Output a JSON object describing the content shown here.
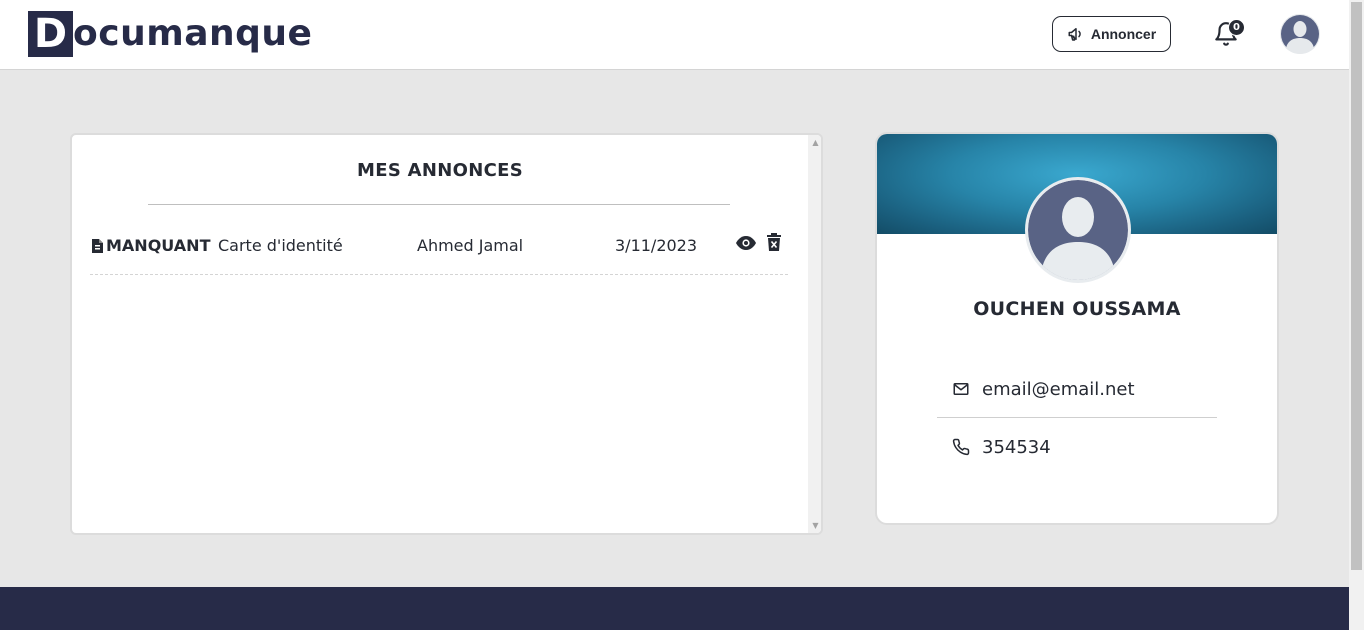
{
  "header": {
    "logo_letter": "D",
    "logo_rest": "ocumanque",
    "annoncer_label": "Annoncer",
    "notification_count": "0"
  },
  "annonces": {
    "title": "MES ANNONCES",
    "rows": [
      {
        "type": "MANQUANT",
        "document": "Carte d'identité",
        "name": "Ahmed Jamal",
        "date": "3/11/2023"
      }
    ]
  },
  "profile": {
    "name": "OUCHEN OUSSAMA",
    "email": "email@email.net",
    "phone": "354534"
  },
  "icons": {
    "annoncer": "megaphone-icon",
    "notifications": "bell-icon",
    "user": "user-avatar-icon",
    "type": "document-icon",
    "view": "eye-icon",
    "delete": "trash-icon",
    "email": "mail-icon",
    "phone": "phone-icon"
  },
  "colors": {
    "brand": "#272b48",
    "background": "#e7e7e7",
    "banner": "#2784a8"
  }
}
